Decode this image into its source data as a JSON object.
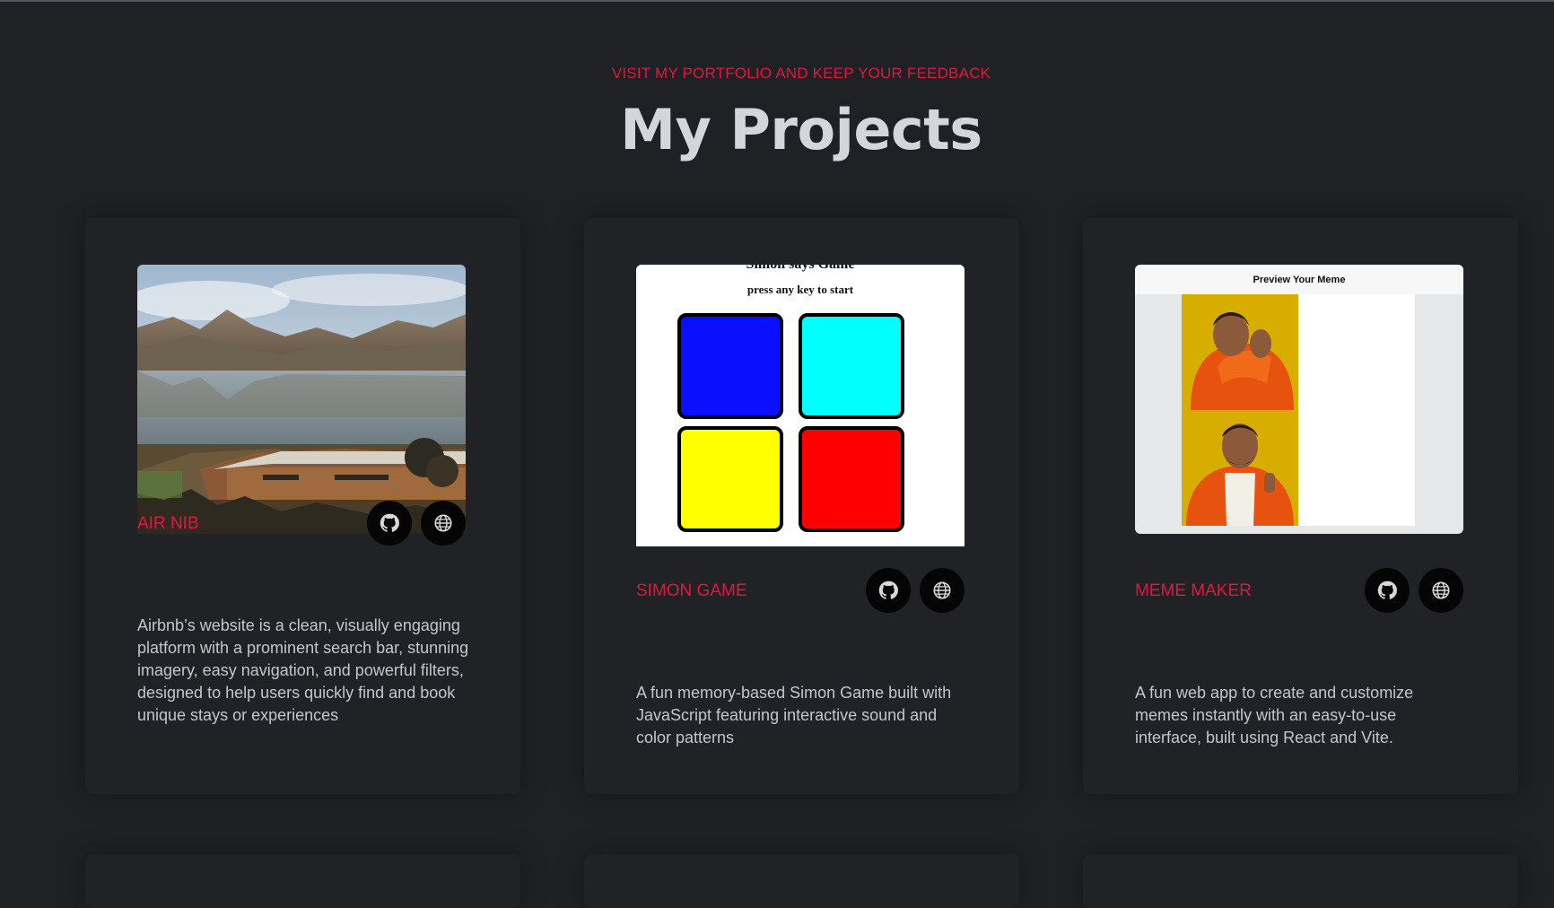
{
  "header": {
    "subtitle": "VISIT MY PORTFOLIO AND KEEP YOUR FEEDBACK",
    "title": "My Projects"
  },
  "projects": [
    {
      "name": "AIR NIB",
      "description": "Airbnb’s website is a clean, visually engaging platform with a prominent search bar, stunning imagery, easy navigation, and powerful filters, designed to help users quickly find and book unique stays or experiences"
    },
    {
      "name": "SIMON GAME",
      "description": "A fun memory-based Simon Game built with JavaScript featuring interactive sound and color patterns",
      "preview": {
        "title": "Simon says Game",
        "subtitle": "press any key to start",
        "colors": [
          "#0a10ff",
          "#00ffff",
          "#ffff00",
          "#ff0000"
        ]
      }
    },
    {
      "name": "MEME MAKER",
      "description": "A fun web app to create and customize memes instantly with an easy-to-use interface, built using React and Vite.",
      "preview": {
        "title": "Preview Your Meme"
      }
    }
  ],
  "icons": {
    "github": "github-icon",
    "website": "globe-icon"
  },
  "colors": {
    "background": "#1f2125",
    "card": "#202226",
    "accent": "#e0173f",
    "title": "#d4d6dc",
    "text": "#c3c6cd"
  }
}
